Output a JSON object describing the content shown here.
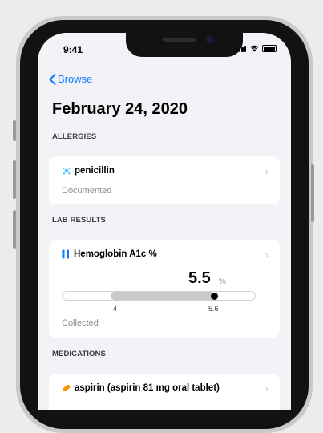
{
  "status": {
    "time": "9:41"
  },
  "nav": {
    "back_label": "Browse"
  },
  "page_title": "February 24, 2020",
  "allergies": {
    "header": "ALLERGIES",
    "item": {
      "name": "penicillin",
      "status": "Documented"
    }
  },
  "lab_results": {
    "header": "LAB RESULTS",
    "item": {
      "name": "Hemoglobin A1c %",
      "value": "5.5",
      "unit": "%",
      "range_low": "4",
      "range_high": "5.6",
      "value_fraction": 0.79,
      "status": "Collected"
    }
  },
  "medications": {
    "header": "MEDICATIONS",
    "item": {
      "name": "aspirin (aspirin 81 mg oral tablet)"
    }
  },
  "colors": {
    "accent": "#0a7aff",
    "allergy_icon": "#5ac8fa",
    "lab_icon": "#0a7aff",
    "med_icon": "#ff9500"
  }
}
